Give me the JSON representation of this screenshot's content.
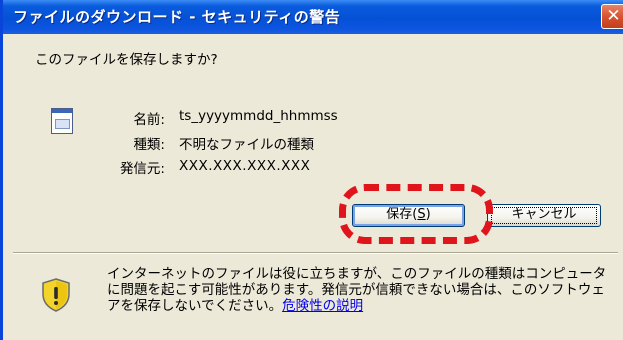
{
  "window": {
    "title": "ファイルのダウンロード - セキュリティの警告",
    "close_label": "✕"
  },
  "dialog": {
    "question": "このファイルを保存しますか?",
    "file_icon": "file-icon",
    "fields": [
      {
        "label": "名前:",
        "value": "ts_yyyymmdd_hhmmss"
      },
      {
        "label": "種類:",
        "value": "不明なファイルの種類"
      },
      {
        "label": "発信元:",
        "value": "XXX.XXX.XXX.XXX"
      }
    ]
  },
  "buttons": {
    "save_text": "保存(",
    "save_key": "S",
    "save_close": ")",
    "cancel": "キャンセル"
  },
  "warning": {
    "icon": "shield-warning-icon",
    "text": "インターネットのファイルは役に立ちますが、このファイルの種類はコンピュータに問題を起こす可能性があります。発信元が信頼できない場合は、このソフトウェアを保存しないでください。",
    "link": "危険性の説明"
  },
  "colors": {
    "highlight": "#e0141b",
    "titlebar": "#0a5bdd",
    "dialog_bg": "#ece9d8"
  }
}
